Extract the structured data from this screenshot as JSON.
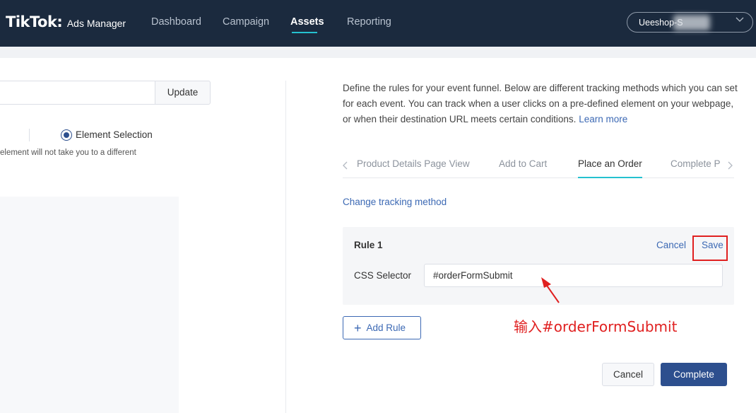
{
  "header": {
    "brand": "TikTok",
    "brand_colon": ":",
    "product": "Ads Manager",
    "nav": [
      {
        "label": "Dashboard"
      },
      {
        "label": "Campaign"
      },
      {
        "label": "Assets"
      },
      {
        "label": "Reporting"
      }
    ],
    "active_nav": "Assets",
    "account": "Ueeshop-S",
    "colors": {
      "background": "#1b2a3e",
      "accent": "#25c1cf"
    }
  },
  "left_panel": {
    "update_label": "Update",
    "tracking_option": "Element Selection",
    "hint": "element will not take you to a different"
  },
  "right_panel": {
    "description": "Define the rules for your event funnel. Below are different tracking methods which you can set for each event. You can track when a user clicks on a pre-defined element on your webpage, or when their destination URL meets certain conditions.",
    "learn_more": "Learn more",
    "tabs": [
      {
        "label": "Product Details Page View"
      },
      {
        "label": "Add to Cart"
      },
      {
        "label": "Place an Order"
      },
      {
        "label": "Complete P"
      }
    ],
    "active_tab": "Place an Order",
    "change_method": "Change tracking method",
    "rule": {
      "title": "Rule 1",
      "cancel_label": "Cancel",
      "save_label": "Save",
      "selector_label": "CSS Selector",
      "selector_value": "#orderFormSubmit"
    },
    "add_rule_label": "Add Rule",
    "cancel_label": "Cancel",
    "complete_label": "Complete"
  },
  "annotation": {
    "text": "输入#orderFormSubmit",
    "color": "#e02020"
  }
}
